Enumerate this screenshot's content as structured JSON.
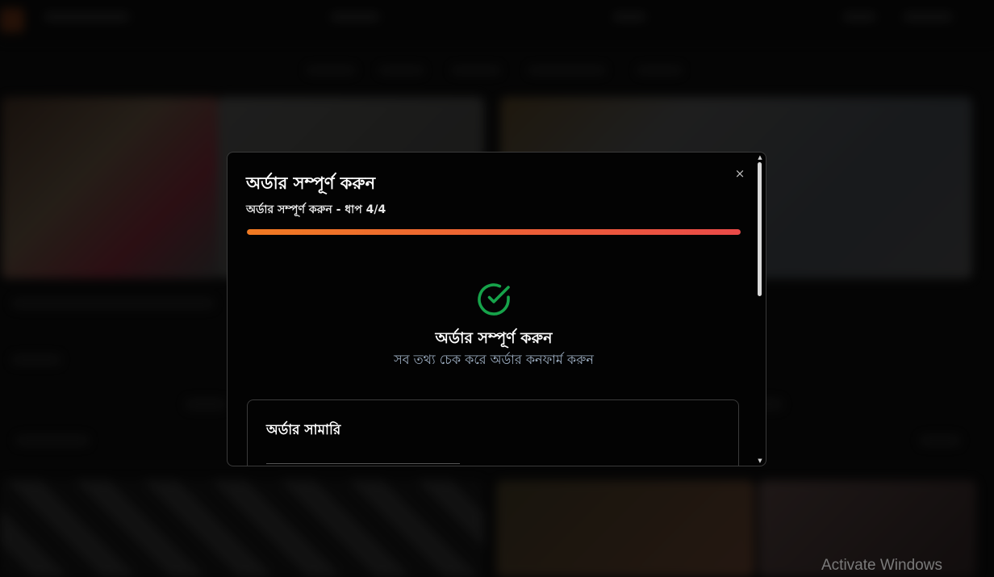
{
  "modal": {
    "title": "অর্ডার সম্পূর্ণ করুন",
    "subtitle": "অর্ডার সম্পূর্ণ করুন - ধাপ 4/4",
    "close_icon": "×",
    "progress": 1.0,
    "progress_colors": [
      "#f07a22",
      "#ea4a48"
    ],
    "step": {
      "icon": "check-circle-icon",
      "icon_color": "#16a34a",
      "heading": "অর্ডার সম্পূর্ণ করুন",
      "description": "সব তথ্য চেক করে অর্ডার কনফার্ম করুন"
    },
    "summary": {
      "title": "অর্ডার সামারি"
    }
  },
  "scrollbar": {
    "up_icon": "▲",
    "down_icon": "▼"
  },
  "watermark": "Activate Windows"
}
